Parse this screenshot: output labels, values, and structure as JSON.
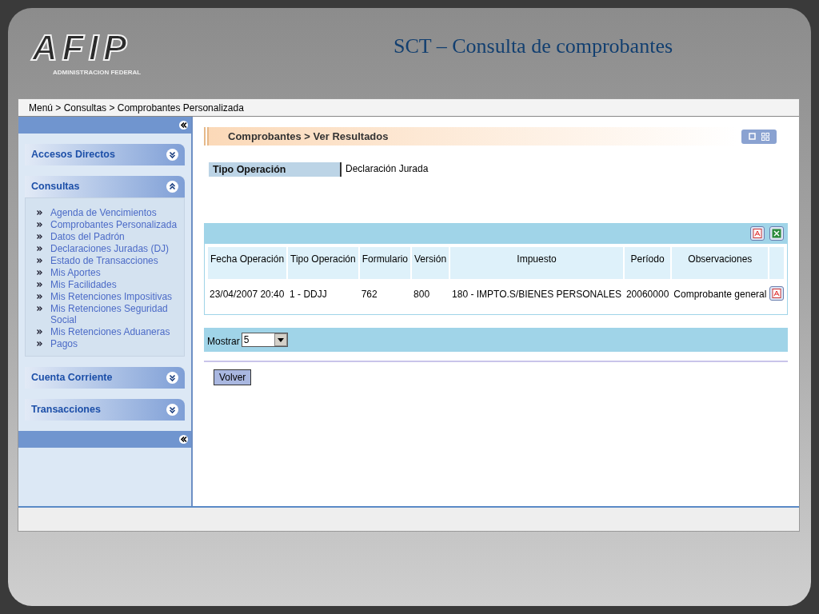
{
  "slide_title": "SCT – Consulta de comprobantes",
  "logo": {
    "mark": "AFIP",
    "subtitle": "ADMINISTRACION FEDERAL"
  },
  "breadcrumb": "Menú > Consultas > Comprobantes Personalizada",
  "sidebar": {
    "sections": [
      {
        "label": "Accesos Directos",
        "expanded": false
      },
      {
        "label": "Consultas",
        "expanded": true,
        "items": [
          "Agenda de Vencimientos",
          "Comprobantes Personalizada",
          "Datos del Padrón",
          "Declaraciones Juradas (DJ)",
          "Estado de Transacciones",
          "Mis Aportes",
          "Mis Facilidades",
          "Mis Retenciones Impositivas",
          "Mis Retenciones Seguridad Social",
          "Mis Retenciones Aduaneras",
          "Pagos"
        ]
      },
      {
        "label": "Cuenta Corriente",
        "expanded": false
      },
      {
        "label": "Transacciones",
        "expanded": false
      }
    ]
  },
  "panel_title": "Comprobantes > Ver Resultados",
  "filter": {
    "label": "Tipo Operación",
    "value": "Declaración Jurada"
  },
  "table": {
    "columns": [
      "Fecha Operación",
      "Tipo Operación",
      "Formulario",
      "Versión",
      "Impuesto",
      "Período",
      "Observaciones"
    ],
    "rows": [
      [
        "23/04/2007 20:40",
        "1 - DDJJ",
        "762",
        "800",
        "180 - IMPTO.S/BIENES PERSONALES",
        "20060000",
        "Comprobante general"
      ]
    ]
  },
  "pager": {
    "label": "Mostrar",
    "value": "5"
  },
  "back_button": "Volver"
}
